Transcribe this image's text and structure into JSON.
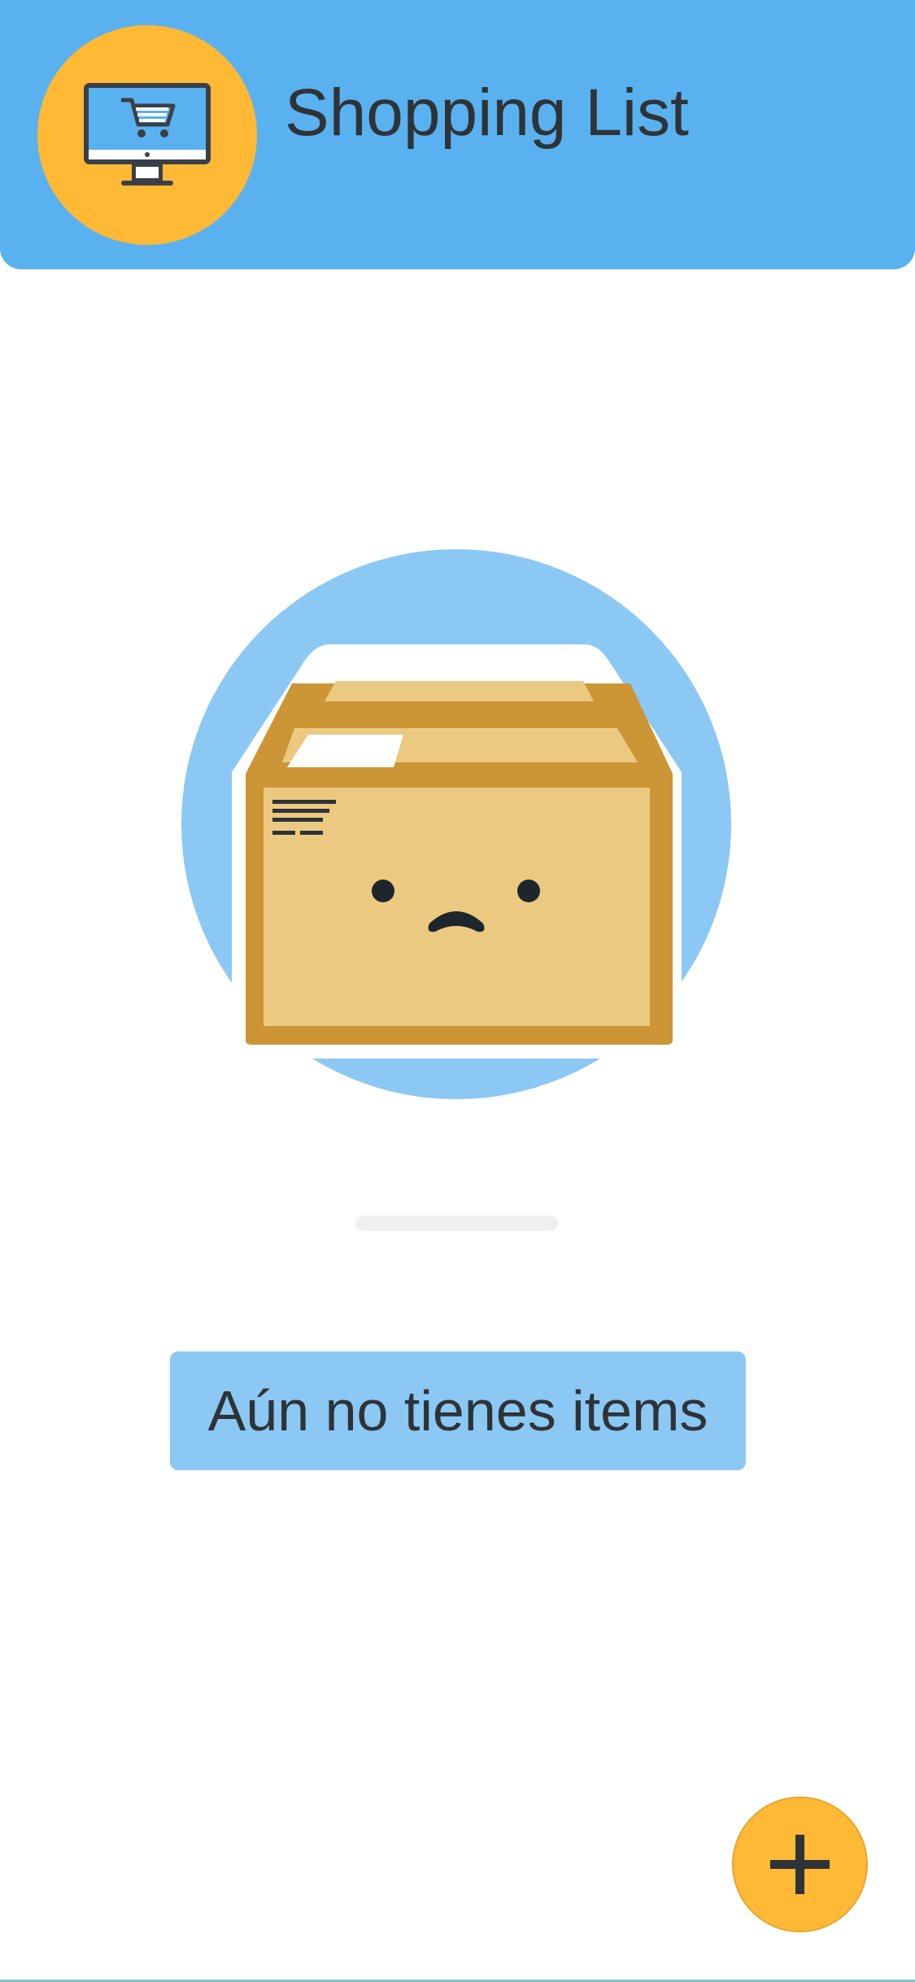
{
  "header": {
    "title": "Shopping List",
    "logo_icon": "monitor-shopping-cart-icon"
  },
  "empty_state": {
    "illustration_icon": "sad-box-icon",
    "message": "Aún no tienes items"
  },
  "fab": {
    "icon": "plus-icon"
  },
  "colors": {
    "header_background": "#5ab1ef",
    "accent_yellow": "#ffb935",
    "message_background": "#8bc8f4",
    "text_dark": "#2e3338"
  }
}
